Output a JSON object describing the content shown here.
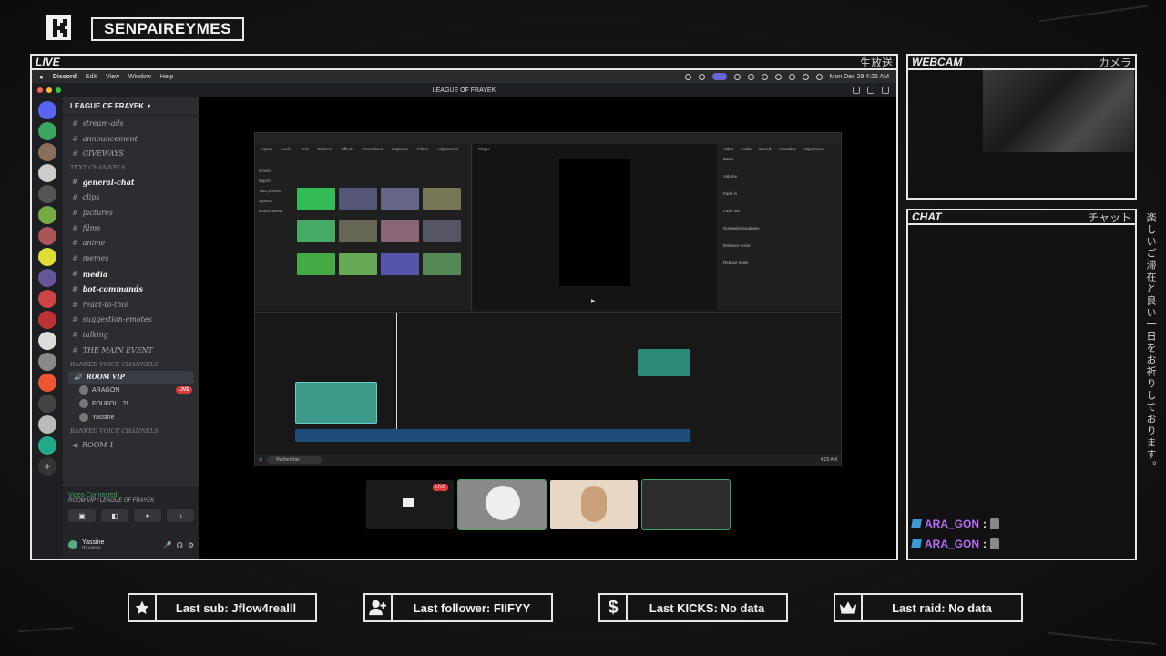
{
  "channel_name": "SENPAIREYMES",
  "live_panel": {
    "title": "LIVE",
    "jp": "生放送"
  },
  "webcam_panel": {
    "title": "WEBCAM",
    "jp": "カメラ"
  },
  "chat_panel": {
    "title": "CHAT",
    "jp": "チャット"
  },
  "side_text": "楽しいご滞在と良い一日をお祈りしております。",
  "menubar": {
    "app": "Discord",
    "items": [
      "Edit",
      "View",
      "Window",
      "Help"
    ],
    "clock": "Mon Dec 29  4:25 AM"
  },
  "discord": {
    "window_title": "LEAGUE OF FRAYEK",
    "guild_name": "LEAGUE OF FRAYEK",
    "channels": [
      {
        "label": "stream-ads",
        "bold": false
      },
      {
        "label": "announcement",
        "bold": false
      },
      {
        "label": "GIVEWAYS",
        "bold": false
      },
      {
        "label": "TEXT CHANNELS",
        "category": true
      },
      {
        "label": "general-chat",
        "bold": true
      },
      {
        "label": "clips",
        "bold": false
      },
      {
        "label": "pictures",
        "bold": false
      },
      {
        "label": "films",
        "bold": false
      },
      {
        "label": "anime",
        "bold": false
      },
      {
        "label": "memes",
        "bold": false
      },
      {
        "label": "media",
        "bold": true
      },
      {
        "label": "bot-commands",
        "bold": true
      },
      {
        "label": "react-to-this",
        "bold": false
      },
      {
        "label": "suggestion-emotes",
        "bold": false
      },
      {
        "label": "talking",
        "bold": false
      },
      {
        "label": "THE MAIN EVENT",
        "bold": false
      },
      {
        "label": "RANKED VOICE CHANNELS",
        "category": true
      }
    ],
    "voice_room": "ROOM VIP",
    "members": [
      {
        "name": "ARAGON",
        "live": "LIVE"
      },
      {
        "name": "FOUFOU..?!",
        "live": ""
      },
      {
        "name": "Yassine",
        "live": ""
      }
    ],
    "category2": "RANKED VOICE CHANNELS",
    "room1": "ROOM 1",
    "voice_status": "Video Connected",
    "voice_location": "ROOM VIP / LEAGUE OF FRAYEK",
    "user": {
      "name": "Yassine",
      "status": "In voice"
    }
  },
  "capcut": {
    "tabs": [
      "Import",
      "Audio",
      "Text",
      "Stickers",
      "Effects",
      "Transitions",
      "Captions",
      "Filters",
      "Adjustment"
    ],
    "side_items": [
      "Device",
      "Import",
      "Your presets",
      "Spaces",
      "Brand assets"
    ],
    "player_label": "Player",
    "props_tabs": [
      "Video",
      "Audio",
      "Speed",
      "Animation",
      "Adjustment"
    ],
    "props_items": [
      "Basic",
      "Volume",
      "Fade in",
      "Fade out",
      "Normalize loudness",
      "Enhance voice",
      "Reduce noise"
    ],
    "search_label": "Rechercher",
    "tray_time": "4:25 AM"
  },
  "chat_messages": [
    {
      "user": "ARA_GON",
      "sep": ":"
    },
    {
      "user": "ARA_GON",
      "sep": ":"
    }
  ],
  "stats": {
    "last_sub": "Last sub: Jflow4realll",
    "last_follower": "Last follower: FIIFYY",
    "last_kicks": "Last KICKS: No data",
    "last_raid": "Last raid: No data"
  },
  "icons": {
    "logo": "kick-logo-icon",
    "sub": "star-icon",
    "follower": "add-user-icon",
    "kicks": "dollar-icon",
    "raid": "crown-icon"
  },
  "colors": {
    "accent_live": "#e13a3a",
    "chat_name": "#b56cf0",
    "connected": "#3ba55d"
  }
}
